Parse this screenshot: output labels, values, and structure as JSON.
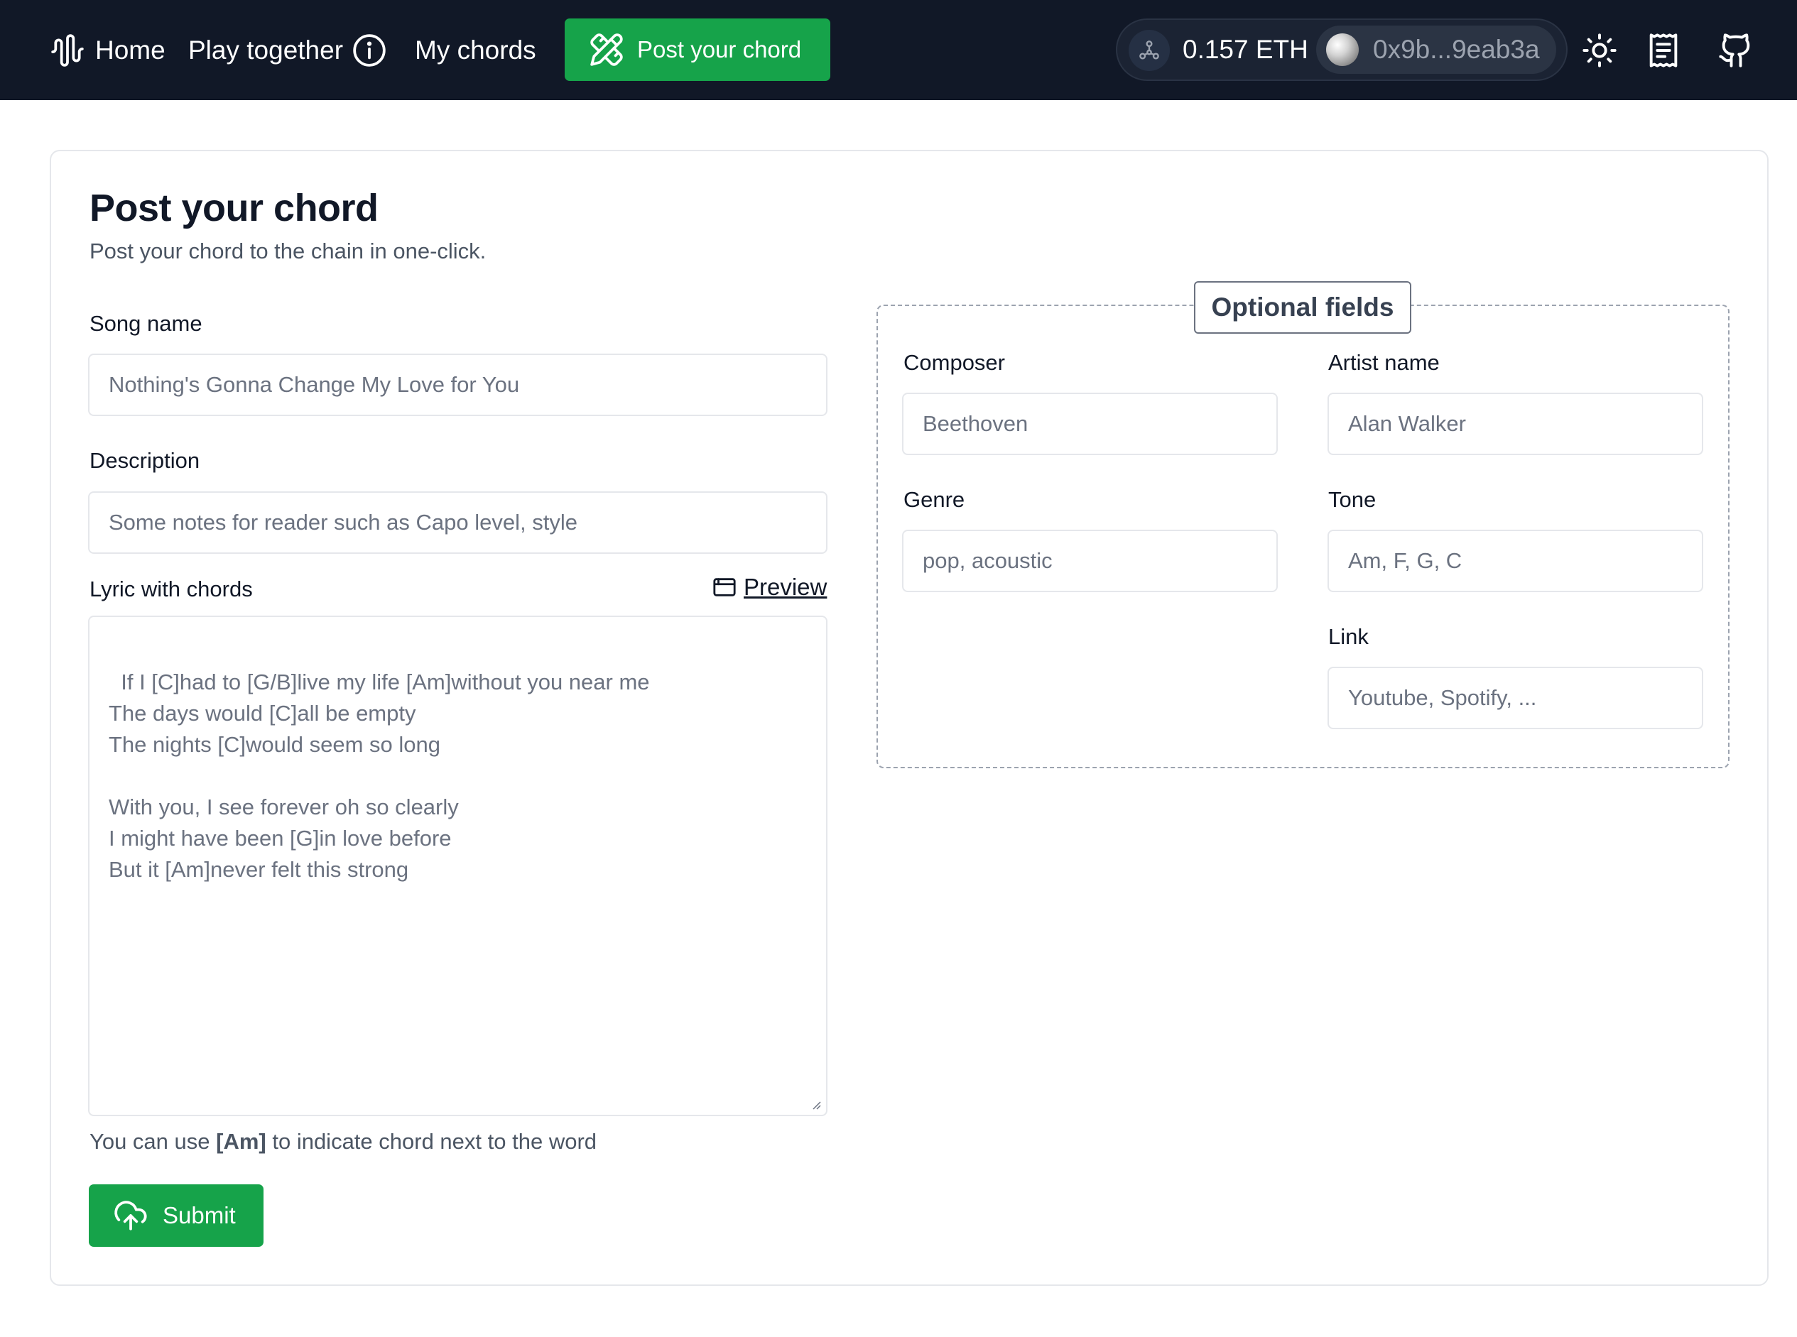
{
  "nav": {
    "home_label": "Home",
    "play_label": "Play together",
    "mychords_label": "My chords",
    "post_label": "Post your chord",
    "balance": "0.157 ETH",
    "address": "0x9b...9eab3a",
    "icons": {
      "home": "waveform-icon",
      "play_info": "info-circle-icon",
      "post": "pencil-ruler-icon",
      "chain": "network-icon",
      "avatar": "account-avatar",
      "theme": "sun-icon",
      "docs": "receipt-icon",
      "github": "github-icon"
    }
  },
  "page": {
    "title": "Post your chord",
    "subtitle": "Post your chord to the chain in one-click."
  },
  "form": {
    "song_name": {
      "label": "Song name",
      "placeholder": "Nothing's Gonna Change My Love for You"
    },
    "description": {
      "label": "Description",
      "placeholder": "Some notes for reader such as Capo level, style"
    },
    "lyrics": {
      "label": "Lyric with chords",
      "preview_label": "Preview",
      "placeholder": "If I [C]had to [G/B]live my life [Am]without you near me\nThe days would [C]all be empty\nThe nights [C]would seem so long\n\nWith you, I see forever oh so clearly\nI might have been [G]in love before\nBut it [Am]never felt this strong"
    },
    "hint_prefix": "You can use ",
    "hint_code": "[Am]",
    "hint_suffix": " to indicate chord next to the word",
    "submit_label": "Submit"
  },
  "optional": {
    "legend": "Optional fields",
    "composer": {
      "label": "Composer",
      "placeholder": "Beethoven"
    },
    "artist": {
      "label": "Artist name",
      "placeholder": "Alan Walker"
    },
    "genre": {
      "label": "Genre",
      "placeholder": "pop, acoustic"
    },
    "tone": {
      "label": "Tone",
      "placeholder": "Am, F, G, C"
    },
    "link": {
      "label": "Link",
      "placeholder": "Youtube, Spotify, ..."
    }
  },
  "colors": {
    "nav_bg": "#111827",
    "accent": "#16a34a",
    "text": "#111827",
    "muted": "#6b7280",
    "border": "#e5e7eb"
  }
}
